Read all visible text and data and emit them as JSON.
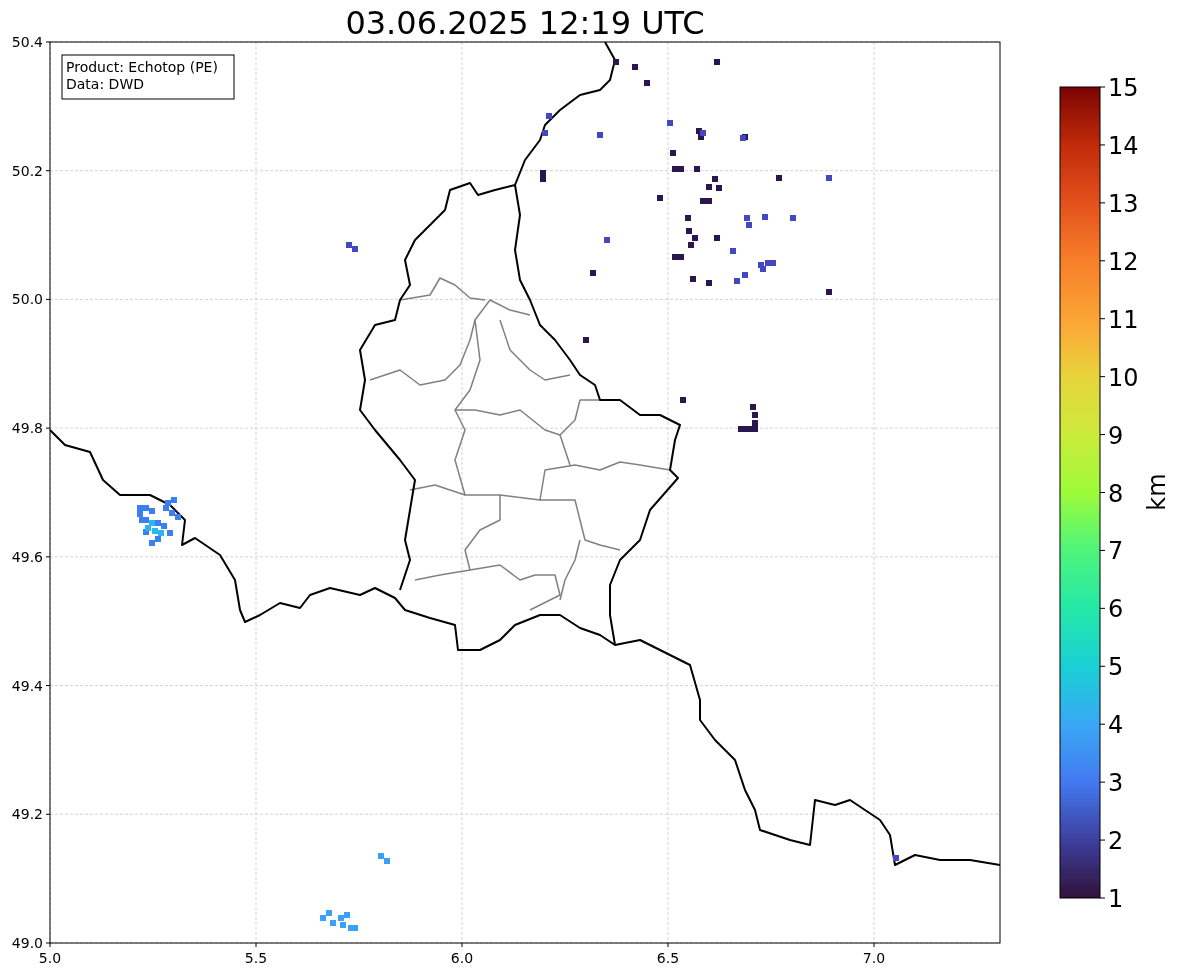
{
  "figure": {
    "title": "03.06.2025 12:19 UTC"
  },
  "map": {
    "x_tick_labels": [
      "5.0",
      "5.5",
      "6.0",
      "6.5",
      "7.0"
    ],
    "y_tick_labels": [
      "50.4",
      "50.2",
      "50.0",
      "49.8",
      "49.6",
      "49.4",
      "49.2",
      "49.0"
    ],
    "info_box": {
      "lines": [
        "Product: Echotop (PE)",
        "Data: DWD"
      ]
    }
  },
  "colorbar": {
    "label": "km",
    "tick_labels": [
      "15",
      "14",
      "13",
      "12",
      "11",
      "10",
      "9",
      "8",
      "7",
      "6",
      "5",
      "4",
      "3",
      "2",
      "1"
    ]
  }
}
